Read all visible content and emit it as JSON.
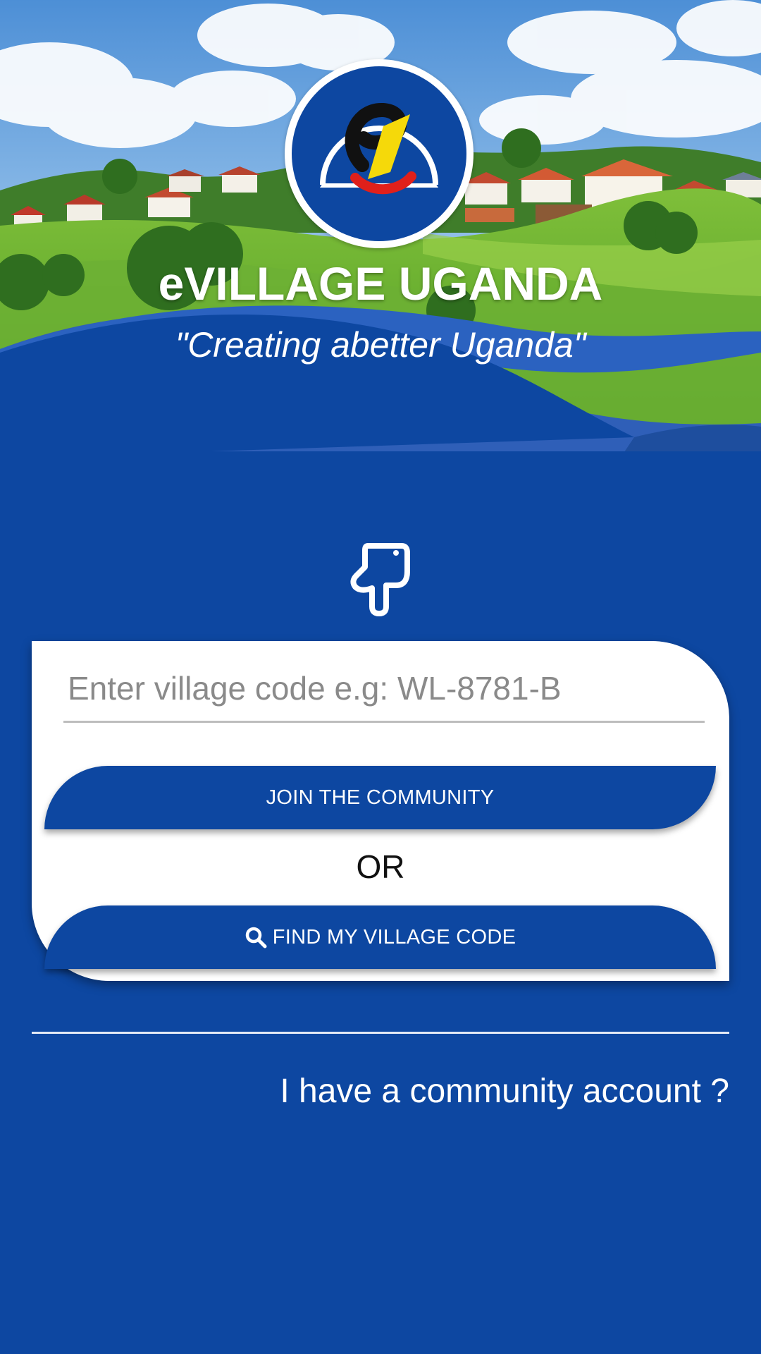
{
  "header": {
    "app_title": "eVILLAGE UGANDA",
    "tagline": "\"Creating abetter Uganda\"",
    "logo_letter": "e"
  },
  "icons": {
    "pointer": "pointing-down-hand-icon",
    "search": "search-icon"
  },
  "form": {
    "village_code_placeholder": "Enter village code e.g: WL-8781-B",
    "village_code_value": "",
    "join_button_label": "JOIN THE COMMUNITY",
    "or_label": "OR",
    "find_button_label": "FIND MY VILLAGE CODE"
  },
  "footer": {
    "account_link": "I have a community account ?"
  },
  "colors": {
    "primary_blue": "#0d47a1",
    "wave_light_blue": "#2f5fb8",
    "card_background": "#ffffff",
    "logo_yellow": "#f5d90a",
    "logo_red": "#e0201b"
  }
}
